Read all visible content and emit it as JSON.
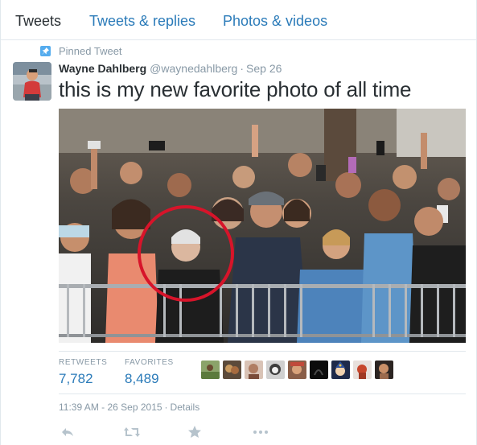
{
  "tabs": [
    {
      "label": "Tweets",
      "active": true
    },
    {
      "label": "Tweets & replies",
      "active": false
    },
    {
      "label": "Photos & videos",
      "active": false
    }
  ],
  "pinned": {
    "label": "Pinned Tweet",
    "icon": "pin-icon"
  },
  "tweet": {
    "fullname": "Wayne Dahlberg",
    "screenname": "@waynedahlberg",
    "separator": "·",
    "date": "Sep 26",
    "text": "this is my new favorite photo of all time",
    "photo_icon": "photo-image"
  },
  "stats": {
    "retweets_label": "RETWEETS",
    "retweets_value": "7,782",
    "favorites_label": "FAVORITES",
    "favorites_value": "8,489"
  },
  "favoriters": [
    "user-avatar-1",
    "user-avatar-2",
    "user-avatar-3",
    "user-avatar-4",
    "user-avatar-5",
    "user-avatar-6",
    "user-avatar-7",
    "user-avatar-8",
    "user-avatar-9"
  ],
  "timestamp": {
    "time": "11:39 AM - 26 Sep 2015",
    "separator": "·",
    "details": "Details"
  },
  "actions": [
    "reply-icon",
    "retweet-icon",
    "favorite-icon",
    "more-icon"
  ],
  "colors": {
    "link": "#2b7bb9",
    "muted": "#8899a6",
    "text": "#292f33",
    "pin": "#55acee",
    "highlight_circle": "#d7142a"
  }
}
